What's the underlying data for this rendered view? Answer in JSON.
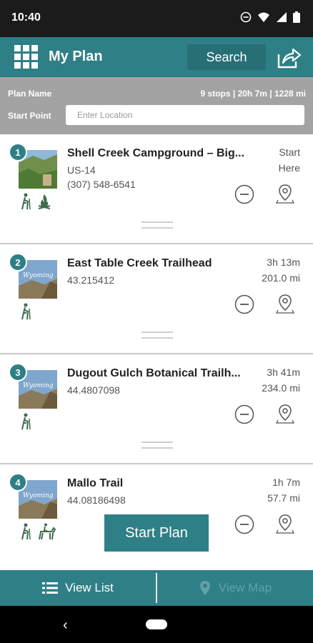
{
  "status_bar": {
    "time": "10:40"
  },
  "header": {
    "title": "My Plan",
    "search_label": "Search"
  },
  "plan": {
    "name_label": "Plan Name",
    "summary": "9 stops | 20h 7m | 1228 mi",
    "start_label": "Start Point",
    "start_placeholder": "Enter Location"
  },
  "stops": [
    {
      "number": "1",
      "name": "Shell Creek Campground – Big...",
      "detail1": "US-14",
      "detail2": "(307) 548-6541",
      "meta1": "Start",
      "meta2": "Here",
      "activities": [
        "hiking-icon",
        "campfire-icon"
      ]
    },
    {
      "number": "2",
      "name": "East Table Creek Trailhead",
      "detail1": "43.215412",
      "meta1": "3h 13m",
      "meta2": "201.0 mi",
      "activities": [
        "hiking-icon"
      ]
    },
    {
      "number": "3",
      "name": "Dugout Gulch Botanical Trailh...",
      "detail1": "44.4807098",
      "meta1": "3h 41m",
      "meta2": "234.0 mi",
      "activities": [
        "hiking-icon"
      ]
    },
    {
      "number": "4",
      "name": "Mallo Trail",
      "detail1": "44.08186498",
      "meta1": "1h 7m",
      "meta2": "57.7 mi",
      "activities": [
        "hiking-icon",
        "horse-riding-icon"
      ]
    }
  ],
  "start_plan_label": "Start Plan",
  "tabs": {
    "list_label": "View List",
    "map_label": "View Map"
  },
  "colors": {
    "accent": "#2f7f86",
    "panel": "#a3a3a3",
    "disabled_tab": "#5fa2a8"
  }
}
